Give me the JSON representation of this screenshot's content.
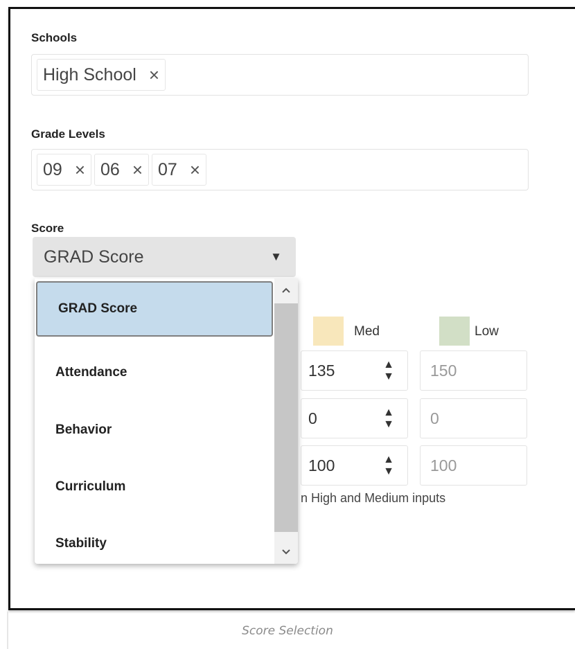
{
  "schools": {
    "label": "Schools",
    "chips": [
      {
        "text": "High School",
        "remove": "×"
      }
    ]
  },
  "grade_levels": {
    "label": "Grade Levels",
    "chips": [
      {
        "text": "09",
        "remove": "×"
      },
      {
        "text": "06",
        "remove": "×"
      },
      {
        "text": "07",
        "remove": "×"
      }
    ]
  },
  "score": {
    "label": "Score",
    "selected": "GRAD Score",
    "caret": "▼",
    "options": [
      "GRAD Score",
      "Attendance",
      "Behavior",
      "Curriculum",
      "Stability"
    ]
  },
  "thresholds": {
    "med_label": "Med",
    "low_label": "Low",
    "med_color": "#f8e7bb",
    "low_color": "#d2dfc6",
    "rows": [
      {
        "med": "135",
        "low": "150"
      },
      {
        "med": "0",
        "low": "0"
      },
      {
        "med": "100",
        "low": "100"
      }
    ],
    "hint": "n High and Medium inputs"
  },
  "icons": {
    "remove": "close-icon",
    "spinner": "spinner-arrows-icon",
    "scroll_up": "chevron-up-icon",
    "scroll_down": "chevron-down-icon"
  },
  "caption": "Score Selection"
}
